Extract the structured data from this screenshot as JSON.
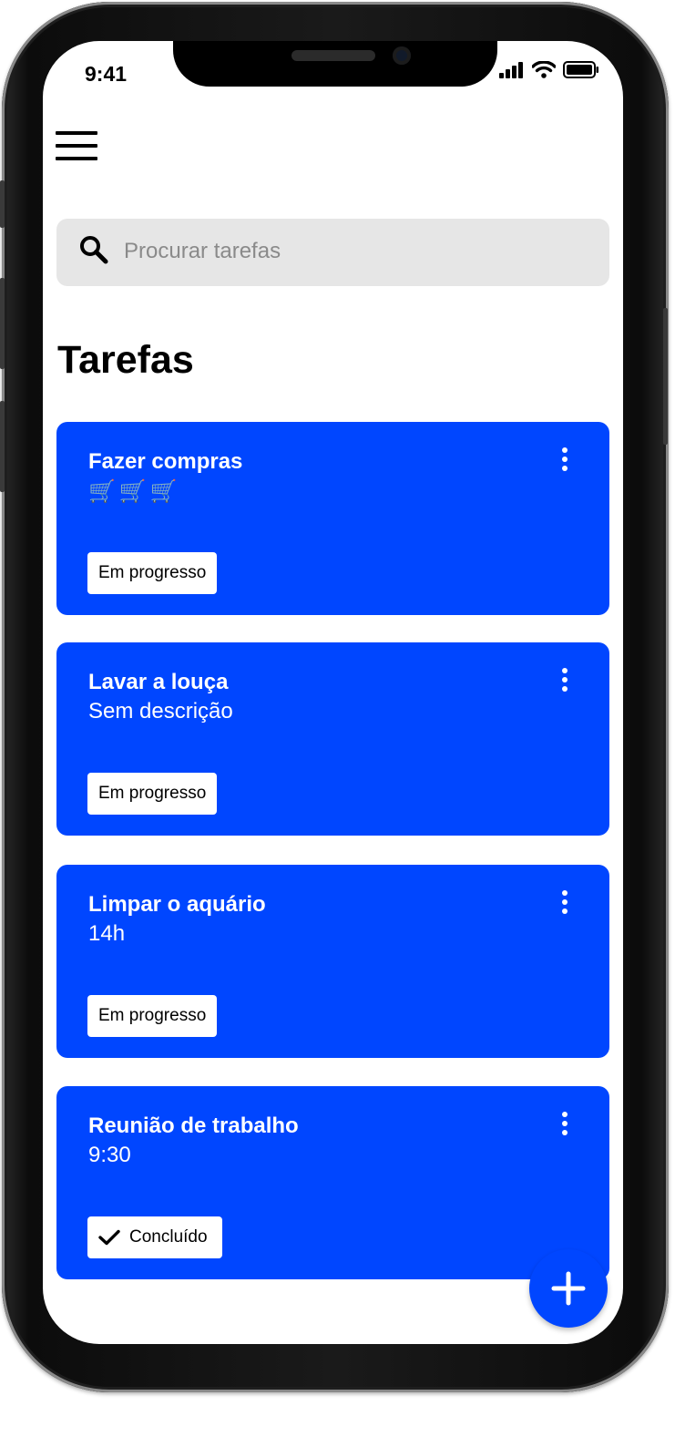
{
  "status_bar": {
    "time": "9:41"
  },
  "search": {
    "placeholder": "Procurar tarefas"
  },
  "page": {
    "title": "Tarefas"
  },
  "tasks": [
    {
      "title": "Fazer compras",
      "description": "🛒🛒🛒",
      "status": "Em progresso"
    },
    {
      "title": "Lavar a louça",
      "description": "Sem descrição",
      "status": "Em progresso"
    },
    {
      "title": "Limpar o aquário",
      "description": "14h",
      "status": "Em progresso"
    },
    {
      "title": "Reunião de trabalho",
      "description": "9:30",
      "status": "Concluído",
      "status_icon": "check-icon"
    }
  ],
  "colors": {
    "accent": "#0046ff",
    "search_bg": "#e6e6e6",
    "chip_bg": "#ffffff"
  },
  "icons": [
    "menu-icon",
    "search-icon",
    "more-vert-icon",
    "check-icon",
    "add-icon",
    "signal-icon",
    "wifi-icon",
    "battery-icon"
  ]
}
